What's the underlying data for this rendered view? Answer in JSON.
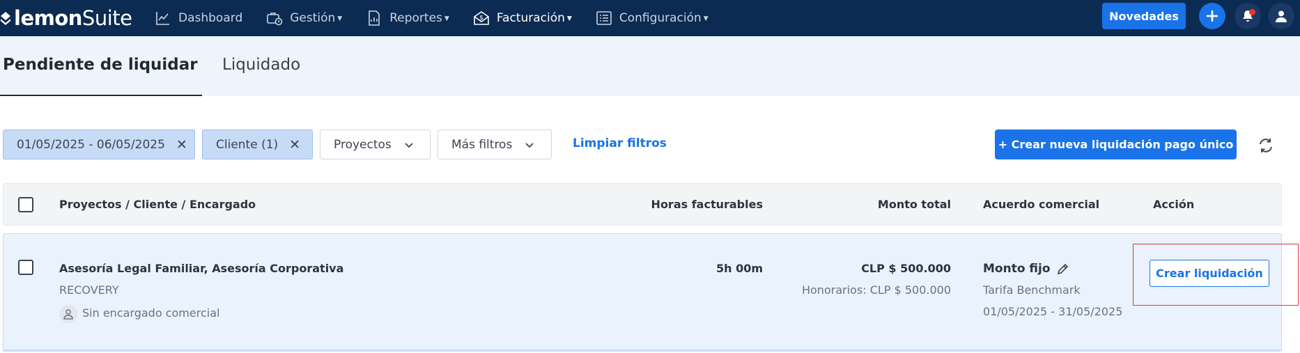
{
  "brand": {
    "bold": "lemon",
    "light": "Suite"
  },
  "nav": [
    {
      "label": "Dashboard",
      "icon": "chart-line-icon",
      "caret": false
    },
    {
      "label": "Gestión",
      "icon": "briefcase-clock-icon",
      "caret": true
    },
    {
      "label": "Reportes",
      "icon": "document-chart-icon",
      "caret": true
    },
    {
      "label": "Facturación",
      "icon": "envelope-dollar-icon",
      "caret": true
    },
    {
      "label": "Configuración",
      "icon": "list-settings-icon",
      "caret": true
    }
  ],
  "header": {
    "novedades_label": "Novedades"
  },
  "tabs": [
    {
      "label": "Pendiente de liquidar",
      "active": true
    },
    {
      "label": "Liquidado",
      "active": false
    }
  ],
  "filters": {
    "date_range": "01/05/2025 - 06/05/2025",
    "client": "Cliente (1)",
    "projects": "Proyectos",
    "more": "Más filtros",
    "clear": "Limpiar filtros"
  },
  "actions": {
    "create_new": "+ Crear nueva liquidación pago único"
  },
  "table": {
    "headers": {
      "projects": "Proyectos / Cliente / Encargado",
      "hours": "Horas facturables",
      "amount": "Monto total",
      "agreement": "Acuerdo comercial",
      "action": "Acción"
    },
    "rows": [
      {
        "project": "Asesoría Legal Familiar, Asesoría Corporativa",
        "client": "RECOVERY",
        "manager": "Sin encargado comercial",
        "hours": "5h 00m",
        "amount": "CLP $ 500.000",
        "fees": "Honorarios: CLP $ 500.000",
        "agreement_type": "Monto fijo",
        "rate": "Tarifa Benchmark",
        "period": "01/05/2025 - 31/05/2025",
        "action_label": "Crear liquidación"
      }
    ]
  },
  "colors": {
    "nav_bg": "#0c2b52",
    "primary": "#1a73e8",
    "row_bg": "#eaf2fd",
    "highlight": "#e53935"
  }
}
